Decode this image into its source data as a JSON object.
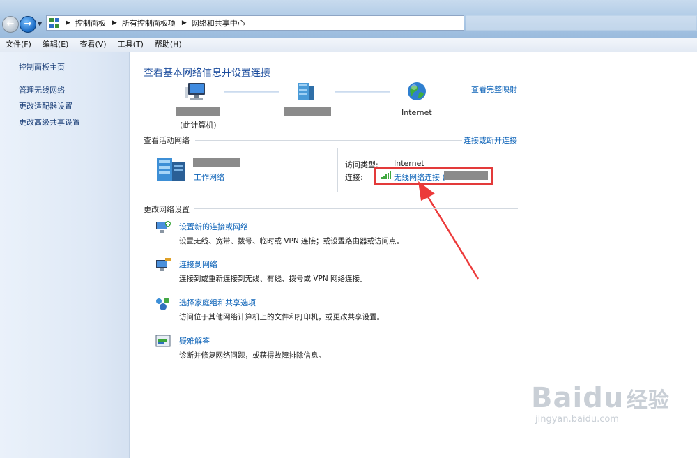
{
  "address": {
    "crumbs": [
      "控制面板",
      "所有控制面板项",
      "网络和共享中心"
    ]
  },
  "menu": [
    "文件(F)",
    "编辑(E)",
    "查看(V)",
    "工具(T)",
    "帮助(H)"
  ],
  "sidebar": {
    "items": [
      "控制面板主页",
      "管理无线网络",
      "更改适配器设置",
      "更改高级共享设置"
    ]
  },
  "main": {
    "title": "查看基本网络信息并设置连接",
    "full_map_link": "查看完整映射",
    "map": {
      "computer_caption": "(此计算机)",
      "internet_label": "Internet"
    },
    "active": {
      "heading": "查看活动网络",
      "connect_link": "连接或断开连接",
      "network_type": "工作网络",
      "access_label": "访问类型:",
      "access_value": "Internet",
      "connection_label": "连接:",
      "connection_link": "无线网络连接 ("
    },
    "change": {
      "heading": "更改网络设置",
      "tasks": [
        {
          "title": "设置新的连接或网络",
          "desc": "设置无线、宽带、拨号、临时或 VPN 连接；或设置路由器或访问点。"
        },
        {
          "title": "连接到网络",
          "desc": "连接到或重新连接到无线、有线、拨号或 VPN 网络连接。"
        },
        {
          "title": "选择家庭组和共享选项",
          "desc": "访问位于其他网络计算机上的文件和打印机，或更改共享设置。"
        },
        {
          "title": "疑难解答",
          "desc": "诊断并修复网络问题，或获得故障排除信息。"
        }
      ]
    }
  },
  "watermark": {
    "brand": "Baidu",
    "brand_cn": "经验",
    "url": "jingyan.baidu.com"
  },
  "colors": {
    "link": "#0d63b8",
    "title": "#1f4f9e",
    "highlight": "#e33a3a"
  }
}
